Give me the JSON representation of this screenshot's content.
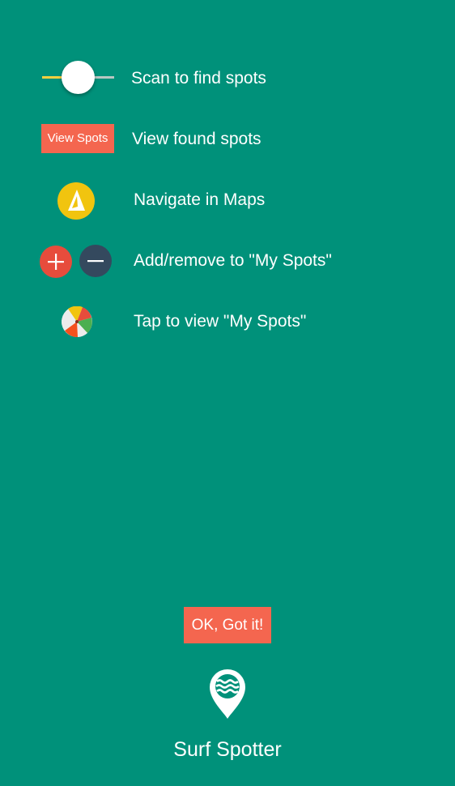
{
  "rows": [
    {
      "label": "Scan to find spots"
    },
    {
      "label": "View found spots",
      "button_label": "View Spots"
    },
    {
      "label": "Navigate in Maps"
    },
    {
      "label": "Add/remove to \"My Spots\""
    },
    {
      "label": "Tap to view \"My Spots\""
    }
  ],
  "slider": {
    "value_fraction": 0.5
  },
  "ok_button": {
    "label": "OK, Got it!"
  },
  "app": {
    "name": "Surf Spotter"
  },
  "icons": {
    "navigate": "navigate-arrow-icon",
    "add": "plus-icon",
    "remove": "minus-icon",
    "my_spots": "beach-ball-icon",
    "logo": "surf-pin-icon"
  },
  "colors": {
    "background": "#00917A",
    "accent_button": "#F4664F",
    "navigate_yellow": "#F1C40F",
    "add_red": "#E74C3C",
    "remove_navy": "#34495E",
    "slider_track_active": "#F4D03F"
  }
}
